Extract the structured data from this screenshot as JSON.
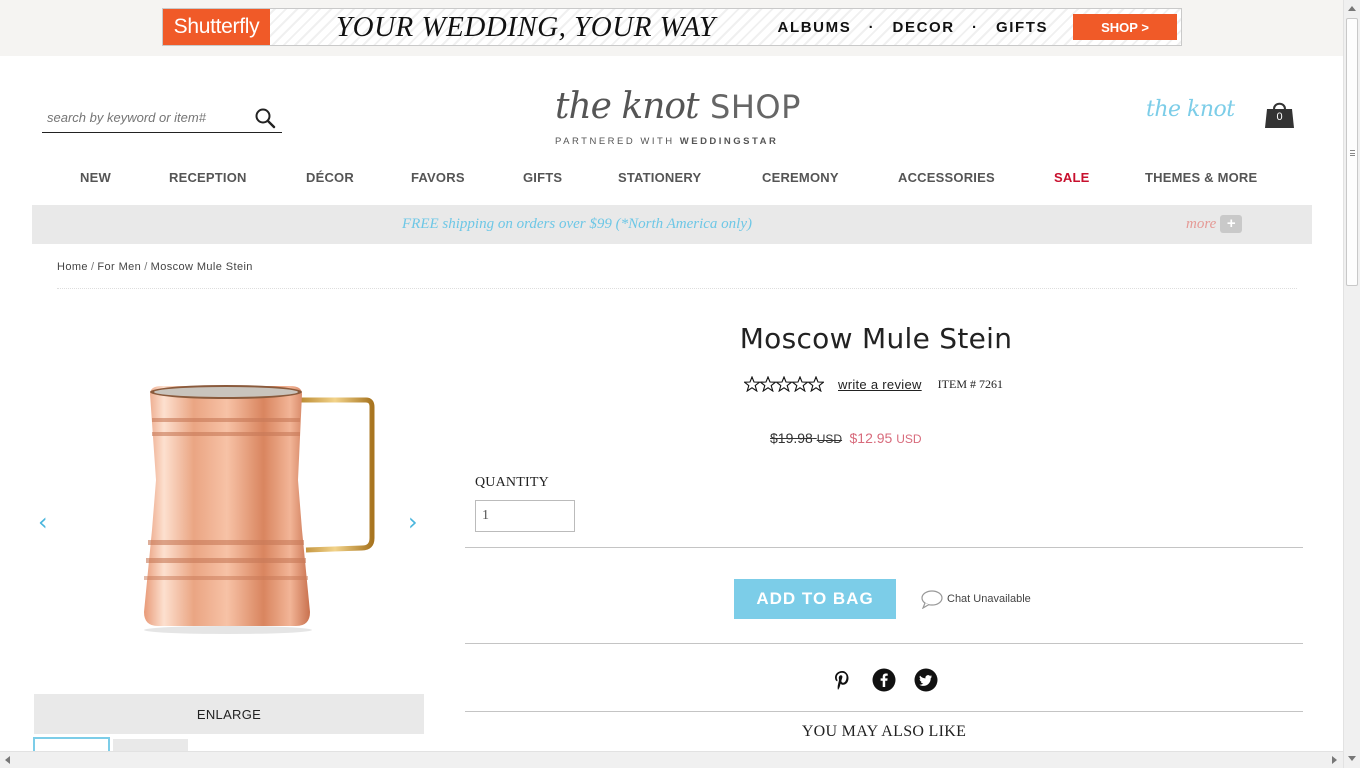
{
  "ad": {
    "brand": "Shutterfly",
    "tagline": "YOUR WEDDING, YOUR WAY",
    "links": [
      "ALBUMS",
      "DECOR",
      "GIFTS"
    ],
    "shop_label": "SHOP >"
  },
  "header": {
    "search_placeholder": "search by keyword or item#",
    "logo_knot": "the knot",
    "logo_shop": "SHOP",
    "logo_partner_prefix": "PARTNERED WITH",
    "logo_partner": "WEDDINGSTAR",
    "theknot_link": "the knot",
    "bag_count": "0"
  },
  "nav": {
    "items": [
      "NEW",
      "RECEPTION",
      "DÉCOR",
      "FAVORS",
      "GIFTS",
      "STATIONERY",
      "CEREMONY",
      "ACCESSORIES",
      "SALE",
      "THEMES & MORE"
    ]
  },
  "promo": {
    "text": "FREE shipping on orders over $99 (*North America only)",
    "more": "more"
  },
  "breadcrumb": [
    "Home",
    "For Men",
    "Moscow Mule Stein"
  ],
  "product": {
    "title": "Moscow Mule Stein",
    "review_link": "write a review",
    "item_number": "ITEM # 7261",
    "old_price": "$19.98",
    "new_price": "$12.95",
    "currency": "USD",
    "quantity_label": "QUANTITY",
    "quantity_value": "1",
    "add_to_bag": "ADD TO BAG",
    "chat_status": "Chat Unavailable",
    "enlarge": "ENLARGE",
    "also_like": "YOU MAY ALSO LIKE",
    "rating_stars": 0
  },
  "colors": {
    "accent_blue": "#7ccde8",
    "sale_red": "#c8102e",
    "price_pink": "#d86b7c",
    "shutterfly_orange": "#f05a28"
  }
}
